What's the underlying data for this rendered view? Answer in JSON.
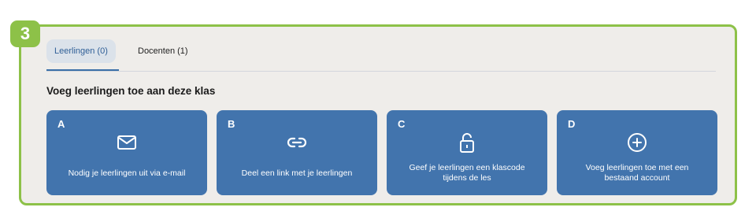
{
  "step": {
    "number": "3"
  },
  "tabs": [
    {
      "label": "Leerlingen (0)",
      "active": true
    },
    {
      "label": "Docenten (1)",
      "active": false
    }
  ],
  "section": {
    "title": "Voeg leerlingen toe aan deze klas"
  },
  "cards": [
    {
      "letter": "A",
      "icon": "mail-icon",
      "label": "Nodig je leerlingen uit via e-mail"
    },
    {
      "letter": "B",
      "icon": "link-icon",
      "label": "Deel een link met je leerlingen"
    },
    {
      "letter": "C",
      "icon": "unlock-icon",
      "label": "Geef je leerlingen een klascode tijdens de les"
    },
    {
      "letter": "D",
      "icon": "plus-circle-icon",
      "label": "Voeg leerlingen toe met een bestaand account"
    }
  ],
  "colors": {
    "frame": "#8dc148",
    "card": "#4274ad",
    "tab_active_bg": "#dbe2ea"
  }
}
